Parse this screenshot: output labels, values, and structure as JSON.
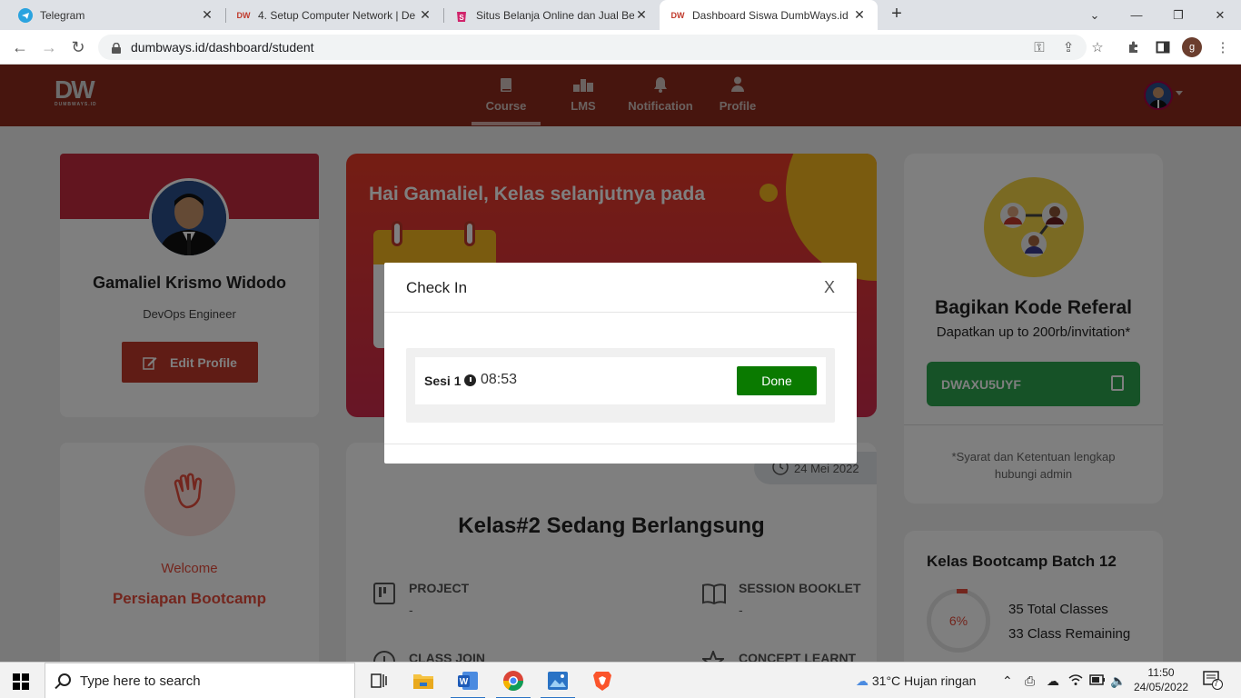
{
  "browser": {
    "tabs": [
      {
        "title": "Telegram",
        "active": false
      },
      {
        "title": "4. Setup Computer Network | De",
        "active": false
      },
      {
        "title": "Situs Belanja Online dan Jual Beli",
        "active": false
      },
      {
        "title": "Dashboard Siswa DumbWays.id |",
        "active": true
      }
    ],
    "url": "dumbways.id/dashboard/student",
    "profile_initial": "g"
  },
  "header": {
    "logo_big": "DW",
    "logo_small": "DUMBWAYS.ID",
    "nav": [
      {
        "label": "Course",
        "icon": "book-icon",
        "active": true
      },
      {
        "label": "LMS",
        "icon": "podium-icon",
        "active": false
      },
      {
        "label": "Notification",
        "icon": "bell-icon",
        "active": false
      },
      {
        "label": "Profile",
        "icon": "person-icon",
        "active": false
      }
    ]
  },
  "profile_card": {
    "name": "Gamaliel Krismo Widodo",
    "role": "DevOps Engineer",
    "edit_label": "Edit Profile"
  },
  "hero": {
    "title": "Hai Gamaliel, Kelas selanjutnya pada"
  },
  "welcome_card": {
    "welcome": "Welcome",
    "stage": "Persiapan Bootcamp"
  },
  "class_card": {
    "date": "24 Mei 2022",
    "title": "Kelas#2 Sedang Berlangsung",
    "items": [
      {
        "label": "PROJECT",
        "value": "-"
      },
      {
        "label": "SESSION BOOKLET",
        "value": "-"
      },
      {
        "label": "CLASS JOIN",
        "value": ""
      },
      {
        "label": "CONCEPT LEARNT",
        "value": ""
      }
    ]
  },
  "referral": {
    "title": "Bagikan Kode Referal",
    "subtitle": "Dapatkan up to 200rb/invitation*",
    "code": "DWAXU5UYF",
    "note": "*Syarat dan Ketentuan lengkap hubungi admin"
  },
  "batch": {
    "title": "Kelas Bootcamp Batch 12",
    "progress_percent": 6,
    "progress_label": "6%",
    "total": "35 Total Classes",
    "remaining": "33 Class Remaining"
  },
  "modal": {
    "title": "Check In",
    "close": "X",
    "session_label": "Sesi 1",
    "session_time": "08:53",
    "done_label": "Done"
  },
  "taskbar": {
    "search_placeholder": "Type here to search",
    "weather": "31°C  Hujan ringan",
    "time": "11:50",
    "date": "24/05/2022",
    "notifications": "7"
  },
  "colors": {
    "header_bg": "#8e2b1c",
    "accent_red": "#c0392b",
    "done_green": "#0a7a00",
    "referral_green": "#2da44e"
  }
}
